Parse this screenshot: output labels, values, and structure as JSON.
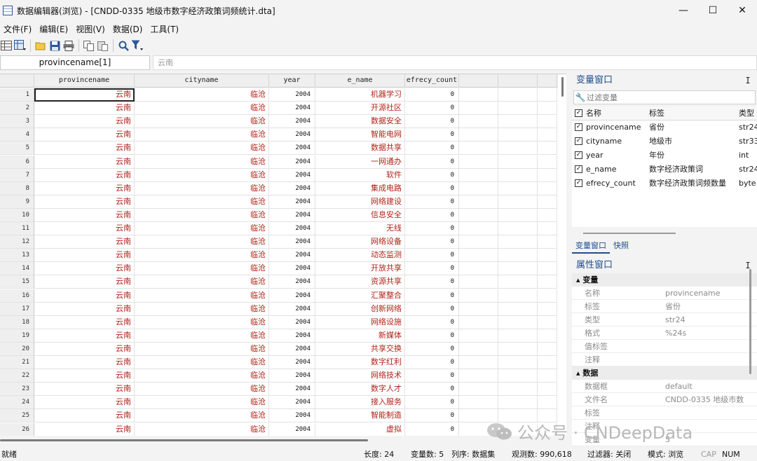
{
  "window": {
    "title": "数据编辑器(浏览) - [CNDD-0335 地级市数字经济政策词频统计.dta]",
    "minimize": "—",
    "maximize": "☐",
    "close": "✕"
  },
  "menu": [
    "文件(F)",
    "编辑(E)",
    "视图(V)",
    "数据(D)",
    "工具(T)"
  ],
  "toolbar": {
    "icons": [
      "table-icon",
      "layout-icon",
      "folder-open-icon",
      "save-icon",
      "print-icon",
      "copy-icon",
      "paste-icon",
      "search-icon",
      "filter-icon"
    ]
  },
  "refbar": {
    "name": "provincename[1]",
    "value": "云南"
  },
  "grid": {
    "columns": [
      "provincename",
      "cityname",
      "year",
      "e_name",
      "efrecy_count"
    ],
    "rows": [
      [
        "1",
        "云南",
        "临沧",
        "2004",
        "机器学习",
        "0"
      ],
      [
        "2",
        "云南",
        "临沧",
        "2004",
        "开源社区",
        "0"
      ],
      [
        "3",
        "云南",
        "临沧",
        "2004",
        "数据安全",
        "0"
      ],
      [
        "4",
        "云南",
        "临沧",
        "2004",
        "智能电网",
        "0"
      ],
      [
        "5",
        "云南",
        "临沧",
        "2004",
        "数据共享",
        "0"
      ],
      [
        "6",
        "云南",
        "临沧",
        "2004",
        "一网通办",
        "0"
      ],
      [
        "7",
        "云南",
        "临沧",
        "2004",
        "软件",
        "0"
      ],
      [
        "8",
        "云南",
        "临沧",
        "2004",
        "集成电路",
        "0"
      ],
      [
        "9",
        "云南",
        "临沧",
        "2004",
        "网络建设",
        "0"
      ],
      [
        "10",
        "云南",
        "临沧",
        "2004",
        "信息安全",
        "0"
      ],
      [
        "11",
        "云南",
        "临沧",
        "2004",
        "无线",
        "0"
      ],
      [
        "12",
        "云南",
        "临沧",
        "2004",
        "网络设备",
        "0"
      ],
      [
        "13",
        "云南",
        "临沧",
        "2004",
        "动态监测",
        "0"
      ],
      [
        "14",
        "云南",
        "临沧",
        "2004",
        "开放共享",
        "0"
      ],
      [
        "15",
        "云南",
        "临沧",
        "2004",
        "资源共享",
        "0"
      ],
      [
        "16",
        "云南",
        "临沧",
        "2004",
        "汇聚整合",
        "0"
      ],
      [
        "17",
        "云南",
        "临沧",
        "2004",
        "创新网络",
        "0"
      ],
      [
        "18",
        "云南",
        "临沧",
        "2004",
        "网络设施",
        "0"
      ],
      [
        "19",
        "云南",
        "临沧",
        "2004",
        "新媒体",
        "0"
      ],
      [
        "20",
        "云南",
        "临沧",
        "2004",
        "共享交换",
        "0"
      ],
      [
        "21",
        "云南",
        "临沧",
        "2004",
        "数字红利",
        "0"
      ],
      [
        "22",
        "云南",
        "临沧",
        "2004",
        "网络技术",
        "0"
      ],
      [
        "23",
        "云南",
        "临沧",
        "2004",
        "数字人才",
        "0"
      ],
      [
        "24",
        "云南",
        "临沧",
        "2004",
        "接入服务",
        "0"
      ],
      [
        "25",
        "云南",
        "临沧",
        "2004",
        "智能制造",
        "0"
      ],
      [
        "26",
        "云南",
        "临沧",
        "2004",
        "虚拟",
        "0"
      ]
    ]
  },
  "variables_panel": {
    "title": "变量窗口",
    "pin": "ⵊ",
    "filter_placeholder": "过滤变量",
    "headers": [
      "名称",
      "标签",
      "类型"
    ],
    "vars": [
      [
        "provincename",
        "省份",
        "str24"
      ],
      [
        "cityname",
        "地级市",
        "str33"
      ],
      [
        "year",
        "年份",
        "int"
      ],
      [
        "e_name",
        "数字经济政策词",
        "str24"
      ],
      [
        "efrecy_count",
        "数字经济政策词频数量",
        "byte"
      ]
    ],
    "tabs": [
      "变量窗口",
      "快照"
    ]
  },
  "properties_panel": {
    "title": "属性窗口",
    "pin": "ⵊ",
    "section_variable": "变量",
    "variable_props": [
      [
        "名称",
        "provincename"
      ],
      [
        "标签",
        "省份"
      ],
      [
        "类型",
        "str24"
      ],
      [
        "格式",
        "%24s"
      ],
      [
        "值标签",
        ""
      ],
      [
        "注释",
        ""
      ]
    ],
    "section_data": "数据",
    "data_props": [
      [
        "数据框",
        "default"
      ],
      [
        "文件名",
        "CNDD-0335 地级市数"
      ],
      [
        "标签",
        ""
      ],
      [
        "注释",
        ""
      ],
      [
        "变量",
        "5"
      ]
    ]
  },
  "watermark": "公众号 · CNDeepData",
  "status": {
    "ready": "就绪",
    "length": "长度: 24",
    "vars": "变量数: 5",
    "order": "列序: 数据集",
    "obs": "观测数: 990,618",
    "filter": "过滤器: 关闭",
    "mode": "模式: 浏览",
    "cap": "CAP",
    "num": "NUM"
  }
}
